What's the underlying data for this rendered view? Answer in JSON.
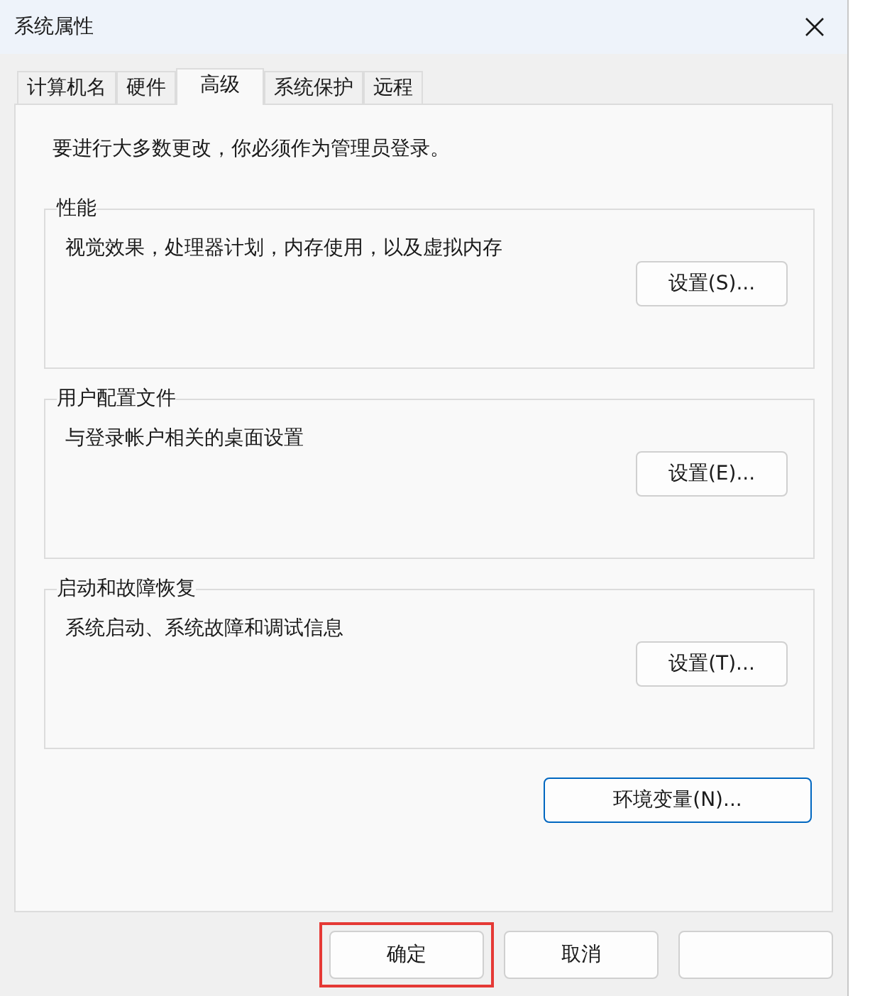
{
  "window": {
    "title": "系统属性"
  },
  "tabs": [
    {
      "label": "计算机名",
      "selected": false
    },
    {
      "label": "硬件",
      "selected": false
    },
    {
      "label": "高级",
      "selected": true
    },
    {
      "label": "系统保护",
      "selected": false
    },
    {
      "label": "远程",
      "selected": false
    }
  ],
  "notice": "要进行大多数更改，你必须作为管理员登录。",
  "groups": [
    {
      "title": "性能",
      "description": "视觉效果，处理器计划，内存使用，以及虚拟内存",
      "button": "设置(S)..."
    },
    {
      "title": "用户配置文件",
      "description": "与登录帐户相关的桌面设置",
      "button": "设置(E)..."
    },
    {
      "title": "启动和故障恢复",
      "description": "系统启动、系统故障和调试信息",
      "button": "设置(T)..."
    }
  ],
  "env_button": "环境变量(N)...",
  "buttons": [
    {
      "kind": "labeled",
      "label": "确定",
      "highlighted": true
    },
    {
      "kind": "labeled",
      "label": "取消",
      "highlighted": false
    },
    {
      "kind": "covered",
      "highlighted": false
    }
  ]
}
